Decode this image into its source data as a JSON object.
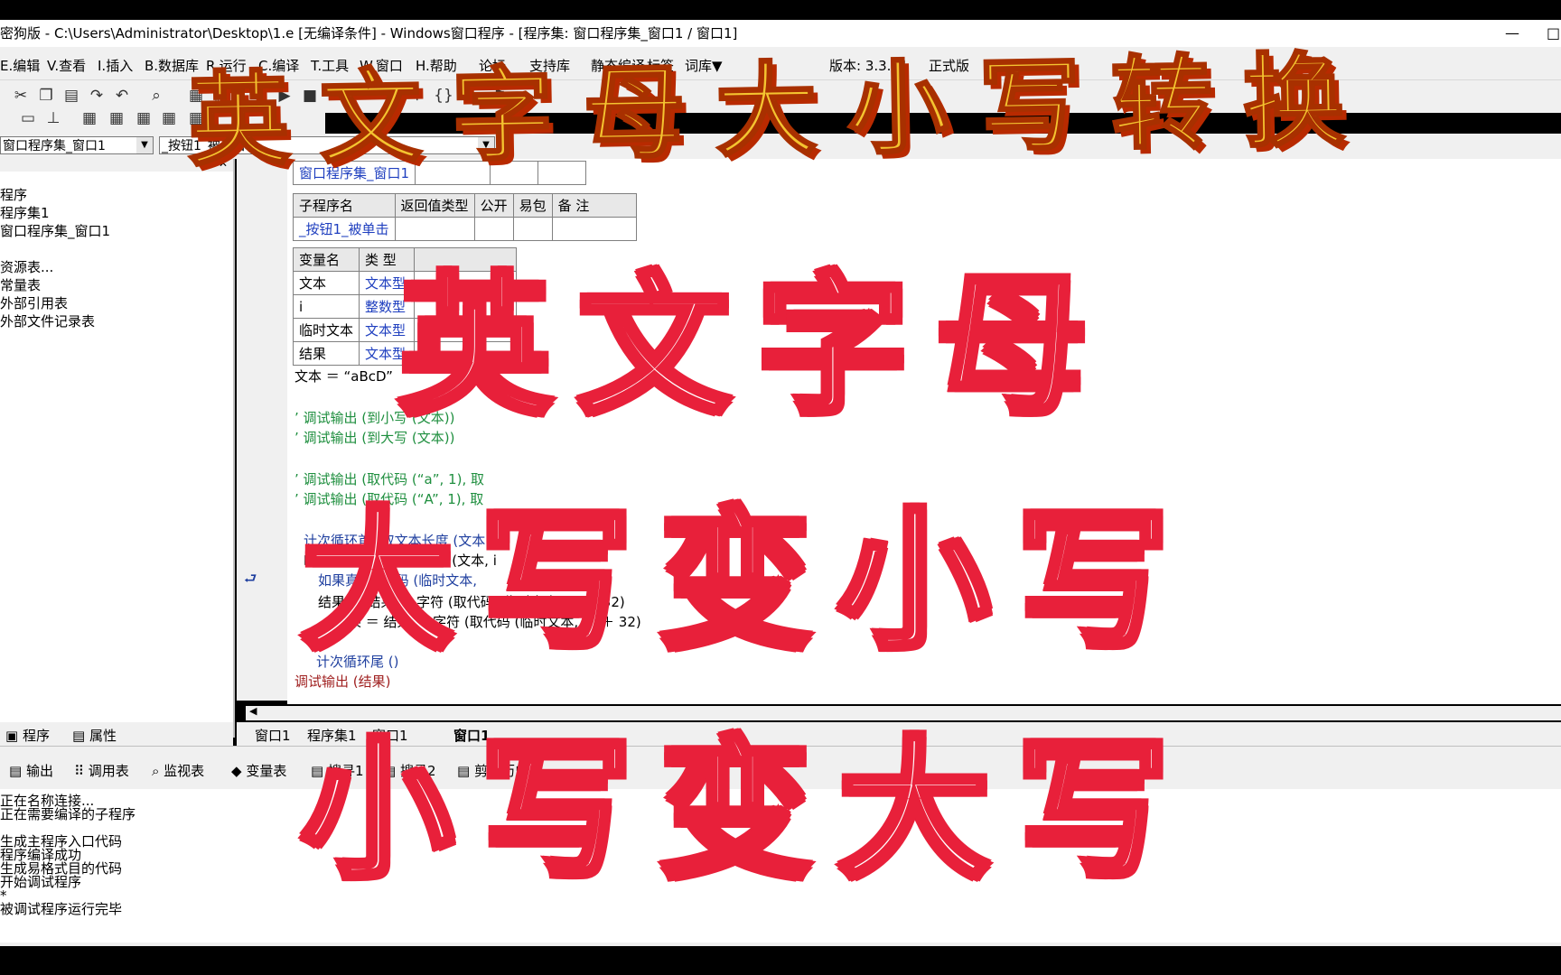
{
  "window": {
    "title": "密狗版 - C:\\Users\\Administrator\\Desktop\\1.e [无编译条件] - Windows窗口程序 - [程序集: 窗口程序集_窗口1 / 窗口1]",
    "minimize": "—",
    "maximize": "□"
  },
  "menu": [
    "E.编辑",
    "V.查看",
    "I.插入",
    "B.数据库",
    "R.运行",
    "C.编译",
    "T.工具",
    "W.窗口",
    "H.帮助",
    "论坛",
    "支持库",
    "静态编译",
    "标签",
    "词库▼",
    "版本: 3.3.01",
    "正式版"
  ],
  "combos": {
    "left": "窗口程序集_窗口1",
    "right": "_按钮1_被单击"
  },
  "left_panel": {
    "tree": [
      "程序",
      "程序集1",
      "窗口程序集_窗口1",
      "",
      "资源表...",
      "常量表",
      "外部引用表",
      "外部文件记录表"
    ],
    "tabs": [
      "程序",
      "属性"
    ]
  },
  "editor": {
    "assembly_table": [
      "窗口程序集_窗口1"
    ],
    "sub_headers": [
      "子程序名",
      "返回值类型",
      "公开",
      "易包",
      "备 注"
    ],
    "sub_row": [
      "_按钮1_被单击",
      "",
      "",
      "",
      ""
    ],
    "var_headers": [
      "变量名",
      "类 型"
    ],
    "vars": [
      [
        "文本",
        "文本型"
      ],
      [
        "i",
        "整数型"
      ],
      [
        "临时文本",
        "文本型"
      ],
      [
        "结果",
        "文本型"
      ]
    ],
    "code_lines": [
      "文本 ＝ “aBcD”",
      "’ 调试输出 (到小写 (文本))",
      "’ 调试输出 (到大写 (文本))",
      "’ 调试输出 (取代码 (“a”, 1), 取",
      "’ 调试输出 (取代码 (“A”, 1), 取",
      "计次循环首 (取文本长度 (文本), i)",
      "临时文本 ＝ 取文本中间 (文本, i",
      "如果真 (取代码 (临时文本,",
      "结果 ＝ 结果 ＋ 字符 (取代码 (临时文本, 1) － 32)",
      "结果 ＝ 结果 ＋ 字符 (取代码 (临时文本, 1) ＋ 32)",
      "计次循环尾 ()",
      "调试输出 (结果)"
    ]
  },
  "doc_tabs": [
    "窗口1",
    "程序集1",
    "窗口1",
    "窗口1"
  ],
  "output_tabs": [
    "输出",
    "调用表",
    "监视表",
    "变量表",
    "搜寻1",
    "搜寻2",
    "剪辑历史"
  ],
  "output_lines": [
    "正在名称连接...",
    "正在需要编译的子程序",
    "",
    "生成主程序入口代码",
    "程序编译成功",
    "生成易格式目的代码",
    "开始调试程序",
    "*",
    "被调试程序运行完毕"
  ],
  "overlay": {
    "top_banner": "英文字母大小写转换",
    "line1": "英文字母",
    "line2": "大写变小写",
    "line3": "小写变大写"
  }
}
